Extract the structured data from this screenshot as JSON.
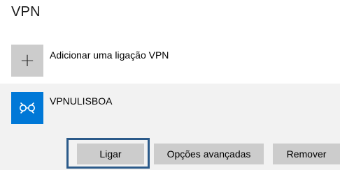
{
  "page": {
    "title": "VPN"
  },
  "add_vpn": {
    "icon": "plus-icon",
    "label": "Adicionar uma ligação VPN"
  },
  "connection": {
    "icon": "vpn-network-icon",
    "name": "VPNULISBOA",
    "buttons": {
      "connect": "Ligar",
      "advanced": "Opções avançadas",
      "remove": "Remover"
    }
  },
  "colors": {
    "accent": "#0078d7",
    "focus_ring": "#2b5a8a",
    "button_bg": "#cccccc",
    "panel_bg": "#f2f2f2"
  }
}
